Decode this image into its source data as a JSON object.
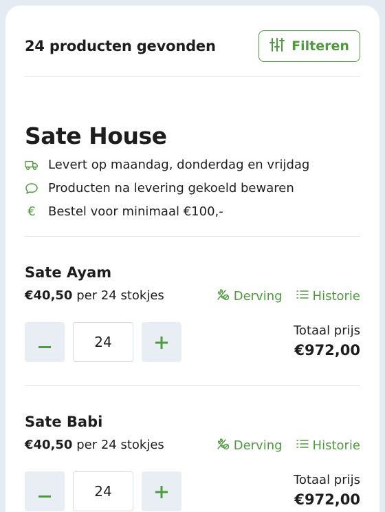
{
  "results": {
    "count_text": "24 producten gevonden",
    "filter_label": "Filteren"
  },
  "shop": {
    "name": "Sate House",
    "info": [
      {
        "icon": "truck-icon",
        "text": "Levert op maandag, donderdag en vrijdag"
      },
      {
        "icon": "chat-bubble-icon",
        "text": "Producten na levering gekoeld bewaren"
      },
      {
        "icon": "euro-icon",
        "text": "Bestel voor minimaal €100,-"
      }
    ]
  },
  "products": [
    {
      "name": "Sate Ayam",
      "price": "€40,50",
      "unit": "per 24 stokjes",
      "derving_label": "Derving",
      "historie_label": "Historie",
      "quantity": "24",
      "total_label": "Totaal prijs",
      "total": "€972,00"
    },
    {
      "name": "Sate Babi",
      "price": "€40,50",
      "unit": "per 24 stokjes",
      "derving_label": "Derving",
      "historie_label": "Historie",
      "quantity": "24",
      "total_label": "Totaal prijs",
      "total": "€972,00"
    }
  ],
  "colors": {
    "accent": "#4e9a3e",
    "background": "#e4ebf2",
    "stepper_bg": "#e8eef3"
  }
}
